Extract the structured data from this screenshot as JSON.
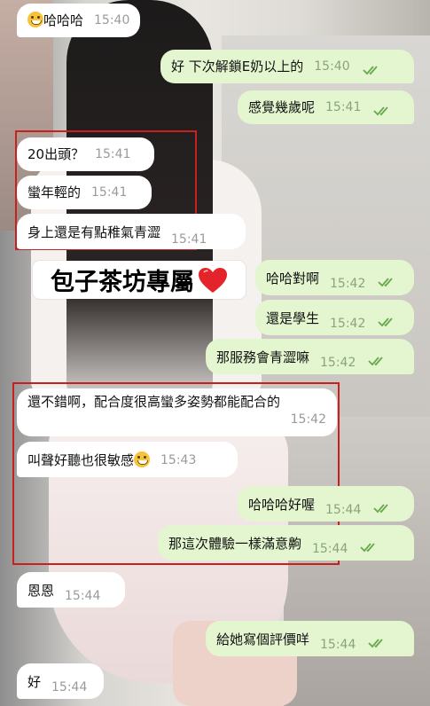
{
  "messages": [
    {
      "id": "m1",
      "side": "in",
      "text": "哈哈哈",
      "time": "15:40",
      "emoji": true
    },
    {
      "id": "m2",
      "side": "out",
      "text": "好 下次解鎖E奶以上的",
      "time": "15:40"
    },
    {
      "id": "m3",
      "side": "out",
      "text": "感覺幾歲呢",
      "time": "15:41"
    },
    {
      "id": "m4",
      "side": "in",
      "text": "20出頭？",
      "time": "15:41"
    },
    {
      "id": "m5",
      "side": "in",
      "text": "蠻年輕的",
      "time": "15:41"
    },
    {
      "id": "m6",
      "side": "in",
      "text": "身上還是有點稚氣青澀",
      "time": "15:41"
    },
    {
      "id": "m7",
      "side": "out",
      "text": "哈哈對啊",
      "time": "15:42"
    },
    {
      "id": "m8",
      "side": "out",
      "text": "還是學生",
      "time": "15:42"
    },
    {
      "id": "m9",
      "side": "out",
      "text": "那服務會青澀嘛",
      "time": "15:42"
    },
    {
      "id": "m10",
      "side": "in",
      "text": "還不錯啊，配合度很高蠻多姿勢都能配合的",
      "time": "15:42"
    },
    {
      "id": "m11",
      "side": "in",
      "text": "叫聲好聽也很敏感",
      "time": "15:43",
      "emoji": true
    },
    {
      "id": "m12",
      "side": "out",
      "text": "哈哈哈好喔",
      "time": "15:44"
    },
    {
      "id": "m13",
      "side": "out",
      "text": "那這次體驗一樣滿意齁",
      "time": "15:44"
    },
    {
      "id": "m14",
      "side": "in",
      "text": "恩恩",
      "time": "15:44"
    },
    {
      "id": "m15",
      "side": "out",
      "text": "給她寫個評價咩",
      "time": "15:44"
    },
    {
      "id": "m16",
      "side": "in",
      "text": "好",
      "time": "15:44"
    }
  ],
  "banner": {
    "text": "包子茶坊專屬",
    "icon": "red-heart-icon"
  },
  "colors": {
    "incoming": "#ffffff",
    "outgoing": "#e4f6cf",
    "highlight_box": "#c8201e",
    "read_check": "#6aa84f"
  }
}
